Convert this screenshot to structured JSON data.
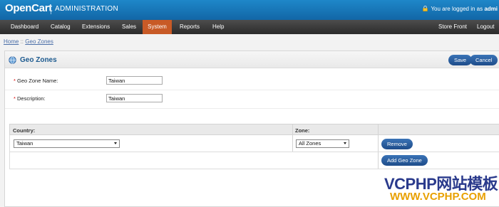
{
  "header": {
    "brand": "OpenCart",
    "subtitle": "ADMINISTRATION",
    "login_prefix": "You are logged in as",
    "login_user": "admi"
  },
  "menu": {
    "dashboard": "Dashboard",
    "catalog": "Catalog",
    "extensions": "Extensions",
    "sales": "Sales",
    "system": "System",
    "reports": "Reports",
    "help": "Help",
    "store_front": "Store Front",
    "logout": "Logout"
  },
  "breadcrumb": {
    "home": "Home",
    "separator": "::",
    "current": "Geo Zones"
  },
  "page": {
    "title": "Geo Zones",
    "save_label": "Save",
    "cancel_label": "Cancel"
  },
  "form": {
    "required_mark": "*",
    "name_label": "Geo Zone Name:",
    "name_value": "Taiwan",
    "description_label": "Description:",
    "description_value": "Taiwan"
  },
  "zones_table": {
    "country_header": "Country:",
    "zone_header": "Zone:",
    "rows": [
      {
        "country": "Taiwan",
        "zone": "All Zones",
        "remove_label": "Remove"
      }
    ],
    "add_label": "Add Geo Zone"
  },
  "watermark": {
    "line1": "VCPHP网站模板",
    "line2": "WWW.VCPHP.COM"
  },
  "colors": {
    "header_blue": "#1a7cbf",
    "menu_active": "#c85a26",
    "button_blue": "#2a5e9e",
    "title_blue": "#1c5a8f"
  }
}
